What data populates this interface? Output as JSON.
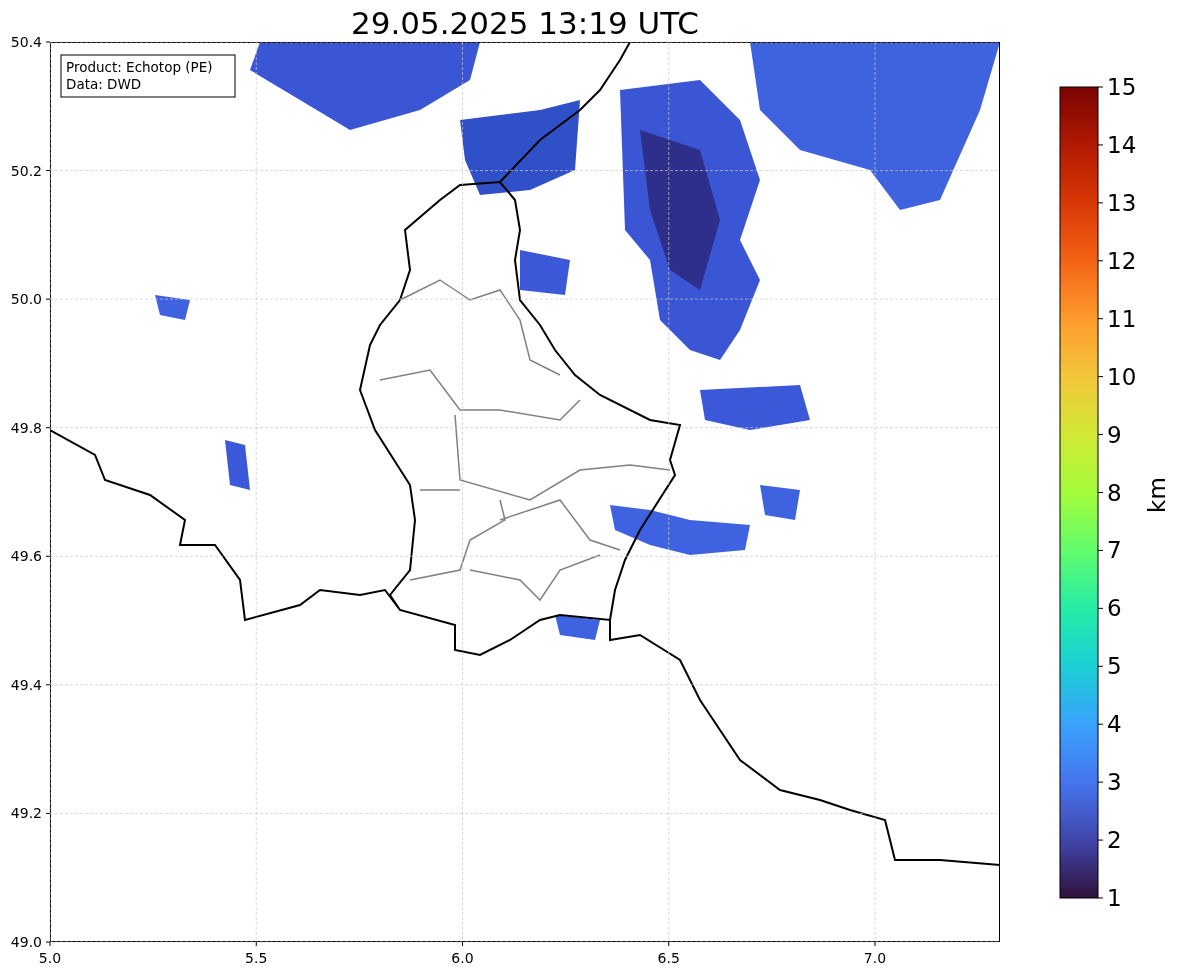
{
  "title": "29.05.2025 13:19 UTC",
  "map": {
    "legend": [
      "Product: Echotop (PE)",
      "Data: DWD"
    ],
    "xticks": [
      "5.0",
      "5.5",
      "6.0",
      "6.5",
      "7.0"
    ],
    "yticks": [
      "50.4",
      "50.2",
      "50.0",
      "49.8",
      "49.6",
      "49.4",
      "49.2",
      "49.0"
    ]
  },
  "colorbar": {
    "label": "km",
    "ticks": [
      "15",
      "14",
      "13",
      "12",
      "11",
      "10",
      "9",
      "8",
      "7",
      "6",
      "5",
      "4",
      "3",
      "2",
      "1"
    ]
  }
}
